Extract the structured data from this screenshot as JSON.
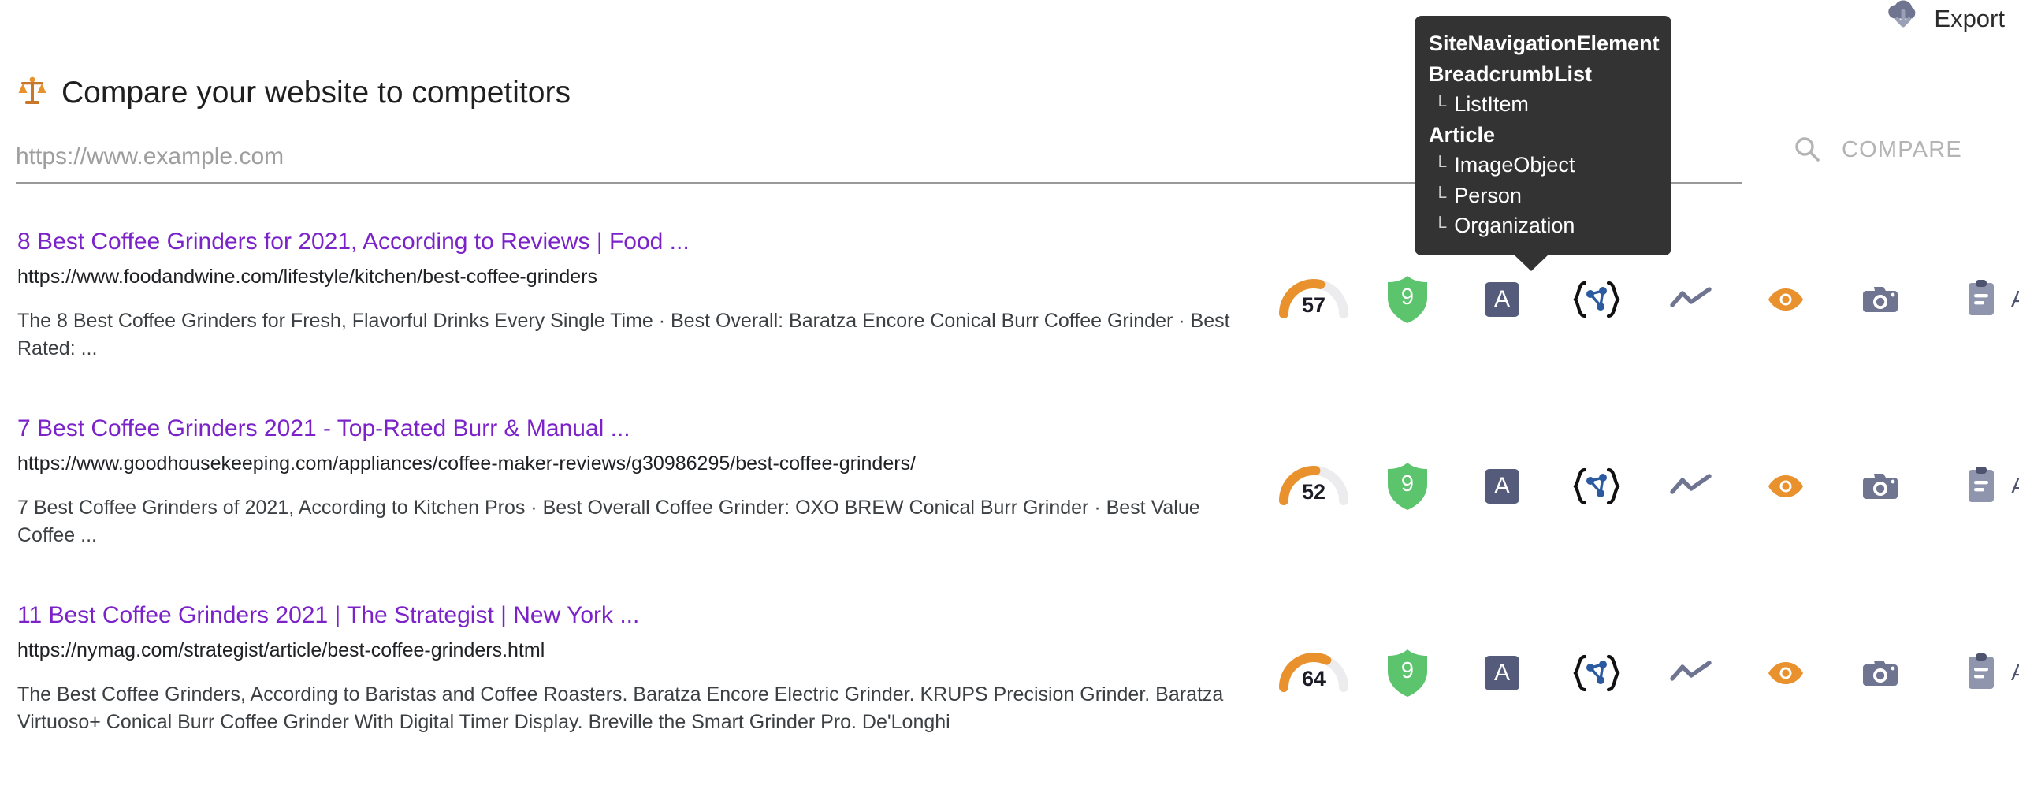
{
  "topbar": {
    "export_label": "Export",
    "export_icon": "cloud-download-icon",
    "export_icon_color": "#6f7590"
  },
  "header": {
    "title": "Compare your website to competitors",
    "title_icon": "balance-scale-icon",
    "title_icon_color": "#E8912D"
  },
  "compare": {
    "input_value": "",
    "input_placeholder": "https://www.example.com",
    "button_label": "COMPARE",
    "button_icon": "search-icon",
    "button_disabled_color": "#b4b4b4"
  },
  "tooltip": {
    "visible": true,
    "background": "#333333",
    "anchor_icon": "structured-data-icon",
    "items": [
      {
        "label": "SiteNavigationElement",
        "level": "parent"
      },
      {
        "label": "BreadcrumbList",
        "level": "parent"
      },
      {
        "label": "ListItem",
        "level": "child"
      },
      {
        "label": "Article",
        "level": "parent"
      },
      {
        "label": "ImageObject",
        "level": "child"
      },
      {
        "label": "Person",
        "level": "child"
      },
      {
        "label": "Organization",
        "level": "child"
      }
    ]
  },
  "metric_icons": {
    "gauge_name": "page-score-gauge",
    "shield_name": "authority-shield",
    "a_badge_name": "accessibility-badge",
    "structured_data_name": "structured-data-icon",
    "trend_name": "trend-line-icon",
    "eye_name": "preview-eye-icon",
    "camera_name": "screenshot-camera-icon",
    "audit_name": "audit-clipboard-icon",
    "audit_label": "Audit",
    "gauge_fill_color": "#E8912D",
    "gauge_track_color": "#ECECEE",
    "shield_color": "#5CC46C",
    "a_badge_color": "#555C7B",
    "trend_color": "#6f7590",
    "eye_color": "#E8912D",
    "camera_color": "#6f7590",
    "audit_color": "#4e5470",
    "braces_color": "#111111",
    "node_color": "#2C5AA0"
  },
  "results": [
    {
      "title": "8 Best Coffee Grinders for 2021, According to Reviews | Food ...",
      "url": "https://www.foodandwine.com/lifestyle/kitchen/best-coffee-grinders",
      "snippet": "The 8 Best Coffee Grinders for Fresh, Flavorful Drinks Every Single Time · Best Overall: Baratza Encore Conical Burr Coffee Grinder · Best Rated: ...",
      "score": "57",
      "score_percent": 57,
      "shield_score": "9",
      "a_badge": "A",
      "audit_label": "Audit"
    },
    {
      "title": "7 Best Coffee Grinders 2021 - Top-Rated Burr & Manual ...",
      "url": "https://www.goodhousekeeping.com/appliances/coffee-maker-reviews/g30986295/best-coffee-grinders/",
      "snippet": "7 Best Coffee Grinders of 2021, According to Kitchen Pros · Best Overall Coffee Grinder: OXO BREW Conical Burr Grinder · Best Value Coffee ...",
      "score": "52",
      "score_percent": 52,
      "shield_score": "9",
      "a_badge": "A",
      "audit_label": "Audit"
    },
    {
      "title": "11 Best Coffee Grinders 2021 | The Strategist | New York ...",
      "url": "https://nymag.com/strategist/article/best-coffee-grinders.html",
      "snippet": "The Best Coffee Grinders, According to Baristas and Coffee Roasters. Baratza Encore Electric Grinder. KRUPS Precision Grinder. Baratza Virtuoso+ Conical Burr Coffee Grinder With Digital Timer Display. Breville the Smart Grinder Pro. De'Longhi",
      "score": "64",
      "score_percent": 64,
      "shield_score": "9",
      "a_badge": "A",
      "audit_label": "Audit"
    }
  ]
}
